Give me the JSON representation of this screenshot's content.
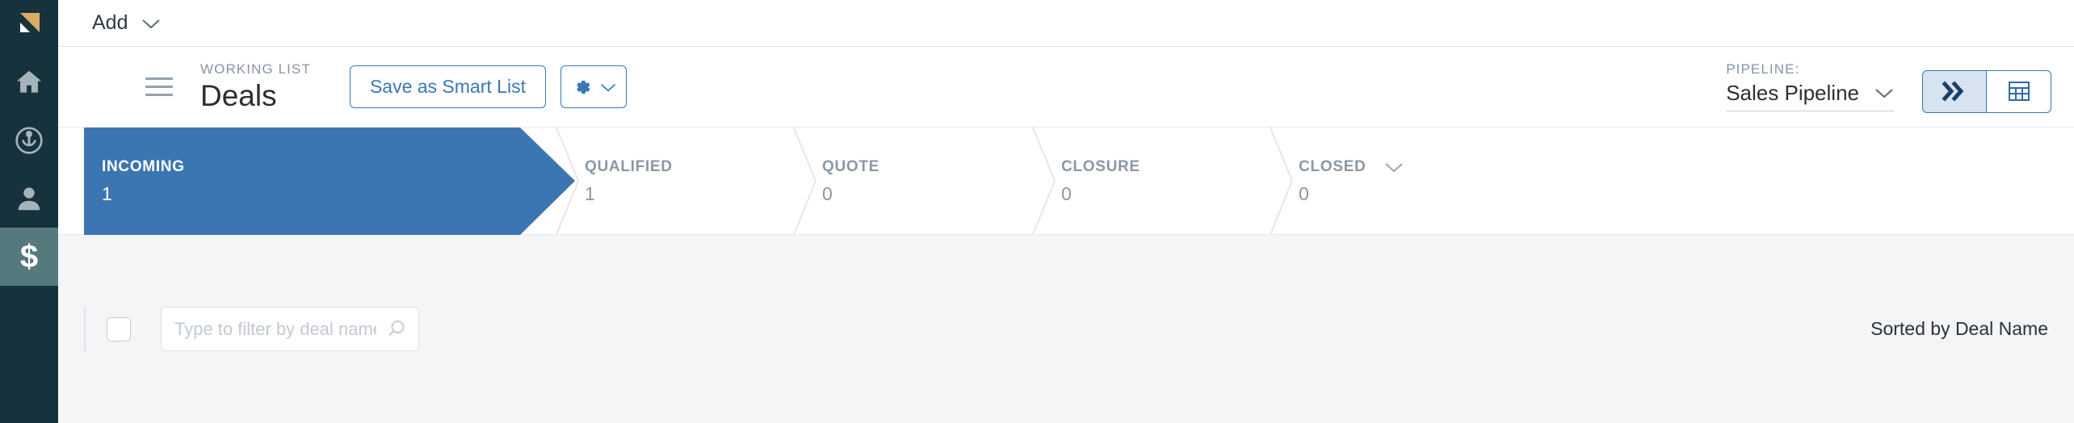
{
  "sidebar": {
    "logo_name": "app-logo",
    "items": [
      {
        "icon": "home-icon",
        "label": "Home",
        "active": false
      },
      {
        "icon": "broadcast-icon",
        "label": "Activity",
        "active": false
      },
      {
        "icon": "person-icon",
        "label": "Contacts",
        "active": false
      },
      {
        "icon": "dollar-icon",
        "label": "Deals",
        "active": true,
        "glyph": "$"
      }
    ],
    "background_color": "#16333d",
    "active_background_color": "#547a7e"
  },
  "topbar": {
    "add_label": "Add",
    "add_caret_icon": "chevron-down-icon"
  },
  "header": {
    "menu_icon": "hamburger-icon",
    "eyebrow": "WORKING LIST",
    "title": "Deals",
    "save_smart_list_label": "Save as Smart List",
    "settings_icon": "gear-icon",
    "settings_caret_icon": "chevron-down-icon",
    "pipeline_label": "PIPELINE:",
    "pipeline_value": "Sales Pipeline",
    "pipeline_caret_icon": "chevron-down-icon",
    "view_toggle": [
      {
        "name": "pipeline-view",
        "icon": "double-chevron-right-icon",
        "active": true
      },
      {
        "name": "table-view",
        "icon": "table-grid-icon",
        "active": false
      }
    ],
    "accent_color": "#3b77b5"
  },
  "stages": [
    {
      "name": "INCOMING",
      "count": "1",
      "active": true,
      "has_caret": false
    },
    {
      "name": "QUALIFIED",
      "count": "1",
      "active": false,
      "has_caret": false
    },
    {
      "name": "QUOTE",
      "count": "0",
      "active": false,
      "has_caret": false
    },
    {
      "name": "CLOSURE",
      "count": "0",
      "active": false,
      "has_caret": false
    },
    {
      "name": "CLOSED",
      "count": "0",
      "active": false,
      "has_caret": true,
      "caret_icon": "chevron-down-icon"
    }
  ],
  "stage_active_color": "#3c76b2",
  "filterbar": {
    "select_all_checkbox": "select-all",
    "filter_placeholder": "Type to filter by deal name",
    "filter_value": "",
    "search_icon": "search-icon",
    "sorted_text": "Sorted by Deal Name",
    "background_color": "#f4f5f7"
  }
}
